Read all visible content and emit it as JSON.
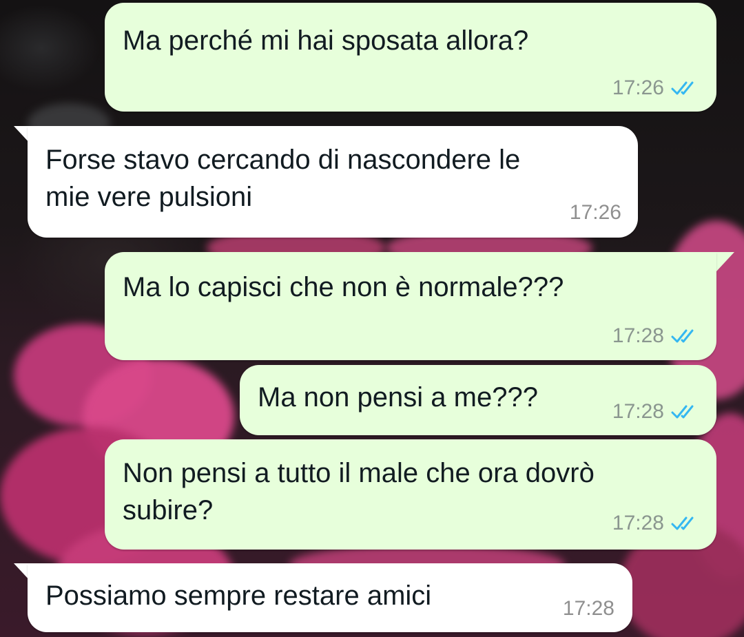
{
  "accent": {
    "tick_color": "#34b7f1",
    "outgoing_bg": "#e7ffdb",
    "incoming_bg": "#ffffff"
  },
  "messages": [
    {
      "direction": "outgoing",
      "text": "Ma perché mi hai sposata allora?",
      "time": "17:26",
      "status_icon": "read-double-check-icon"
    },
    {
      "direction": "incoming",
      "text": "Forse stavo cercando di nascondere le\nmie vere pulsioni",
      "time": "17:26"
    },
    {
      "direction": "outgoing",
      "text": "Ma lo capisci che non è normale???",
      "time": "17:28",
      "status_icon": "read-double-check-icon"
    },
    {
      "direction": "outgoing",
      "text": "Ma non pensi a me???",
      "time": "17:28",
      "status_icon": "read-double-check-icon"
    },
    {
      "direction": "outgoing",
      "text": "Non pensi a tutto il male che ora dovrò\nsubire?",
      "time": "17:28",
      "status_icon": "read-double-check-icon"
    },
    {
      "direction": "incoming",
      "text": "Possiamo sempre restare amici",
      "time": "17:28"
    }
  ]
}
